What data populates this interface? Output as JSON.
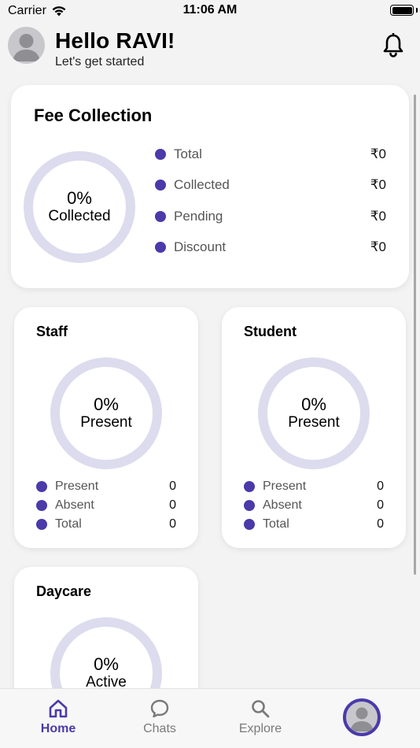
{
  "status_bar": {
    "carrier": "Carrier",
    "time": "11:06 AM"
  },
  "header": {
    "greeting": "Hello RAVI!",
    "subtitle": "Let's get started",
    "bell_icon": "bell-icon",
    "avatar_icon": "user-avatar-icon"
  },
  "fee_collection": {
    "title": "Fee Collection",
    "percent": "0%",
    "percent_label": "Collected",
    "items": [
      {
        "label": "Total",
        "value": "₹0"
      },
      {
        "label": "Collected",
        "value": "₹0"
      },
      {
        "label": "Pending",
        "value": "₹0"
      },
      {
        "label": "Discount",
        "value": "₹0"
      }
    ]
  },
  "staff": {
    "title": "Staff",
    "percent": "0%",
    "percent_label": "Present",
    "items": [
      {
        "label": "Present",
        "value": "0"
      },
      {
        "label": "Absent",
        "value": "0"
      },
      {
        "label": "Total",
        "value": "0"
      }
    ]
  },
  "student": {
    "title": "Student",
    "percent": "0%",
    "percent_label": "Present",
    "items": [
      {
        "label": "Present",
        "value": "0"
      },
      {
        "label": "Absent",
        "value": "0"
      },
      {
        "label": "Total",
        "value": "0"
      }
    ]
  },
  "daycare": {
    "title": "Daycare",
    "percent": "0%",
    "percent_label": "Active"
  },
  "tab_bar": {
    "tabs": [
      {
        "label": "Home",
        "icon": "home-icon",
        "active": true
      },
      {
        "label": "Chats",
        "icon": "chat-bubble-icon",
        "active": false
      },
      {
        "label": "Explore",
        "icon": "search-icon",
        "active": false
      }
    ],
    "profile_icon": "profile-avatar-icon"
  },
  "colors": {
    "accent": "#4a3aaa",
    "ring_track": "#dcdcee",
    "background": "#f3f3f3",
    "card": "#ffffff"
  }
}
